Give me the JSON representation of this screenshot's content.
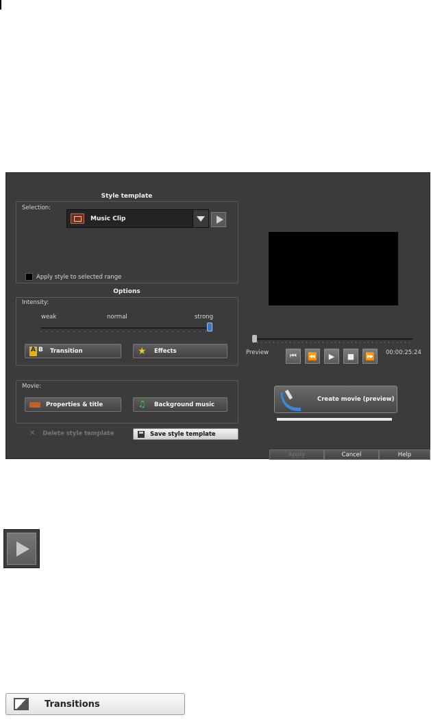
{
  "dialog": {
    "style_template_title": "Style template",
    "selection_label": "Selection:",
    "selection_value": "Music Clip",
    "apply_range_label": "Apply style to selected range",
    "options_title": "Options",
    "intensity_label": "Intensity:",
    "intensity_weak": "weak",
    "intensity_normal": "normal",
    "intensity_strong": "strong",
    "intensity_level": 1.0,
    "transition_label": "Transition",
    "effects_label": "Effects",
    "movie_label": "Movie:",
    "properties_label": "Properties & title",
    "background_music_label": "Background music",
    "delete_template_label": "Delete style template",
    "save_template_label": "Save style template",
    "preview_label": "Preview",
    "timecode": "00:00:25:24",
    "create_movie_label": "Create movie (preview)",
    "apply_label": "Apply",
    "cancel_label": "Cancel",
    "help_label": "Help"
  },
  "icons": {
    "transition_icon_text_a": "A",
    "transition_icon_text_b": "B"
  },
  "transitions_button": {
    "label": "Transitions"
  }
}
